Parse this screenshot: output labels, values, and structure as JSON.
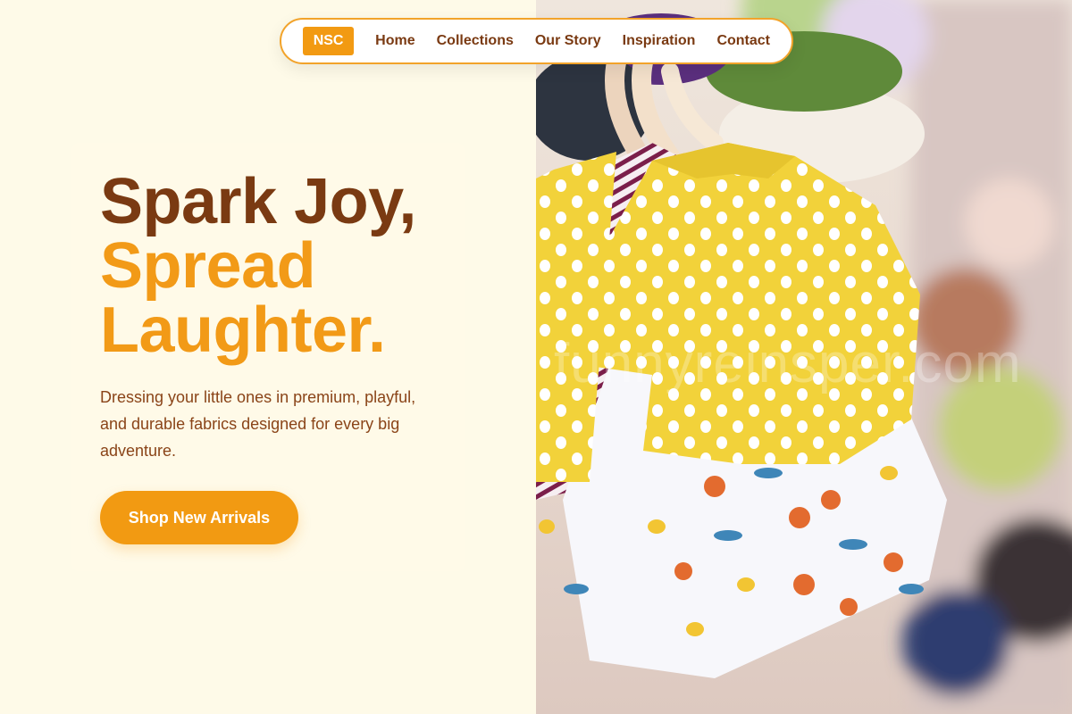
{
  "nav": {
    "logo": "NSC",
    "items": [
      {
        "label": "Home"
      },
      {
        "label": "Collections"
      },
      {
        "label": "Our Story"
      },
      {
        "label": "Inspiration"
      },
      {
        "label": "Contact"
      }
    ]
  },
  "hero": {
    "headline_line1": "Spark Joy,",
    "headline_line2": "Spread",
    "headline_line3": "Laughter.",
    "subtext": "Dressing your little ones in premium, playful, and durable fabrics designed for every big adventure.",
    "cta_label": "Shop New Arrivals"
  },
  "image": {
    "alt": "Children's clothing on hangers",
    "watermark": "funnyreinsper.com"
  },
  "colors": {
    "brand_orange": "#f29a12",
    "brand_brown": "#7a3a12",
    "background": "#fefae8"
  }
}
